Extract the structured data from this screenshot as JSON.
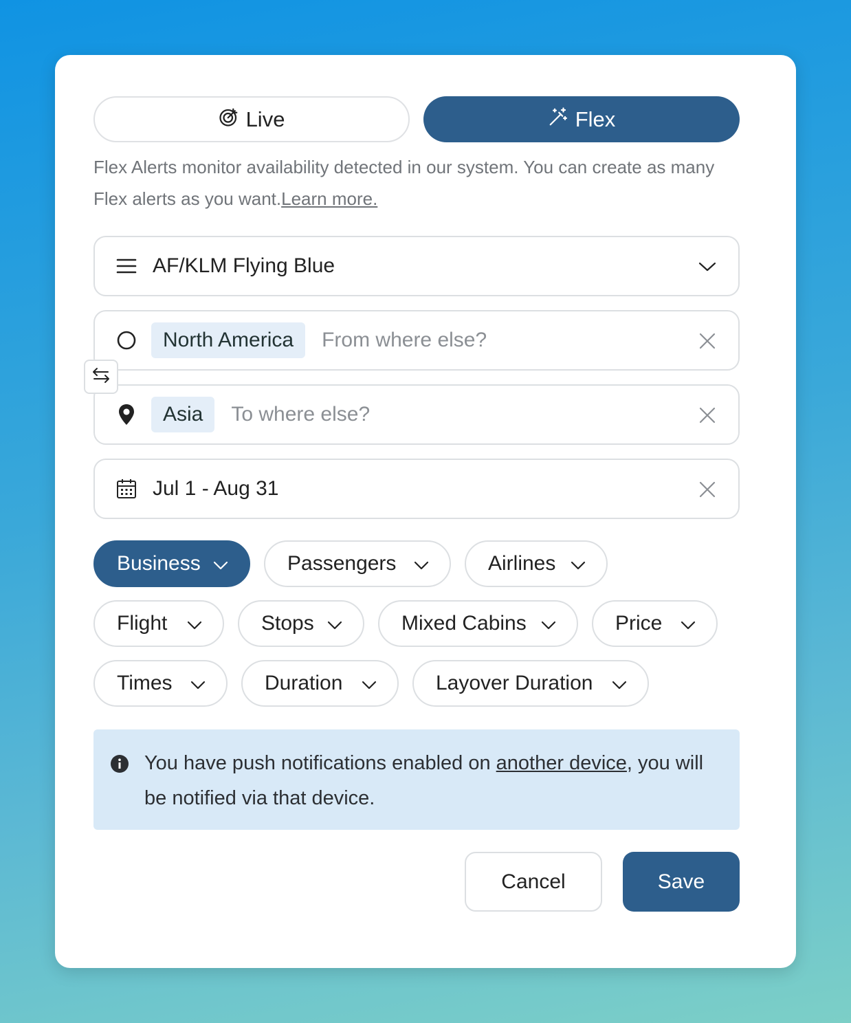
{
  "colors": {
    "primary": "#2d5e8c",
    "chip_bg": "#e4eef8",
    "notice_bg": "#d8e9f7",
    "border": "#dcdfe2"
  },
  "mode_toggle": {
    "live": {
      "label": "Live",
      "icon": "target-icon",
      "selected": false
    },
    "flex": {
      "label": "Flex",
      "icon": "magic-wand-icon",
      "selected": true
    }
  },
  "description": {
    "text": "Flex Alerts monitor availability detected in our system. You can create as many Flex alerts as you want.",
    "link": "Learn more."
  },
  "program_select": {
    "value": "AF/KLM Flying Blue",
    "icon": "menu-icon"
  },
  "origin": {
    "chip": "North America",
    "placeholder": "From where else?",
    "icon": "circle-icon"
  },
  "destination": {
    "chip": "Asia",
    "placeholder": "To where else?",
    "icon": "map-pin-icon"
  },
  "dates": {
    "value": "Jul 1 - Aug 31",
    "icon": "calendar-icon"
  },
  "filters": [
    {
      "label": "Business",
      "active": true
    },
    {
      "label": "Passengers",
      "active": false
    },
    {
      "label": "Airlines",
      "active": false
    },
    {
      "label": "Flight",
      "active": false
    },
    {
      "label": "Stops",
      "active": false
    },
    {
      "label": "Mixed Cabins",
      "active": false
    },
    {
      "label": "Price",
      "active": false
    },
    {
      "label": "Times",
      "active": false
    },
    {
      "label": "Duration",
      "active": false
    },
    {
      "label": "Layover Duration",
      "active": false
    }
  ],
  "notice": {
    "before": "You have push notifications enabled on ",
    "link": "another device",
    "after": ", you will be notified via that device."
  },
  "actions": {
    "cancel": "Cancel",
    "save": "Save"
  }
}
